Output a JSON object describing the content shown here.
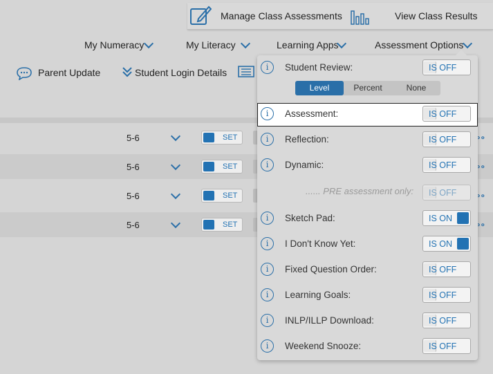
{
  "topbar": {
    "manage_label": "Manage Class Assessments",
    "results_label": "View Class Results",
    "manage_icon": "edit-square-icon",
    "results_icon": "bar-chart-icon"
  },
  "nav": {
    "items": [
      {
        "label": "My Numeracy"
      },
      {
        "label": "My Literacy"
      },
      {
        "label": "Learning Apps"
      },
      {
        "label": "Assessment Options"
      }
    ]
  },
  "subnav": {
    "parent_update": "Parent Update",
    "student_login": "Student Login Details",
    "list_icon": "list-icon"
  },
  "rows": [
    {
      "grade": "5-6",
      "set_label": "SET"
    },
    {
      "grade": "5-6",
      "set_label": "SET"
    },
    {
      "grade": "5-6",
      "set_label": "SET"
    },
    {
      "grade": "5-6",
      "set_label": "SET"
    }
  ],
  "popup": {
    "student_review": {
      "label": "Student Review:",
      "state": "IS OFF"
    },
    "segment": {
      "options": [
        "Level",
        "Percent",
        "None"
      ],
      "selected": "Level"
    },
    "options": [
      {
        "label": "Assessment:",
        "state": "IS OFF",
        "on": false
      },
      {
        "label": "Reflection:",
        "state": "IS OFF",
        "on": false
      },
      {
        "label": "Dynamic:",
        "state": "IS OFF",
        "on": false
      },
      {
        "label": "Sketch Pad:",
        "state": "IS ON",
        "on": true
      },
      {
        "label": "I Don't Know Yet:",
        "state": "IS ON",
        "on": true
      },
      {
        "label": "Fixed Question Order:",
        "state": "IS OFF",
        "on": false
      },
      {
        "label": "Learning Goals:",
        "state": "IS OFF",
        "on": false
      },
      {
        "label": "INLP/ILLP Download:",
        "state": "IS OFF",
        "on": false
      },
      {
        "label": "Weekend Snooze:",
        "state": "IS OFF",
        "on": false
      }
    ],
    "pre_assessment": {
      "label": "...... PRE assessment only:",
      "state": "IS OFF"
    }
  },
  "colors": {
    "accent": "#2272b3",
    "background": "#d5d5d5"
  }
}
